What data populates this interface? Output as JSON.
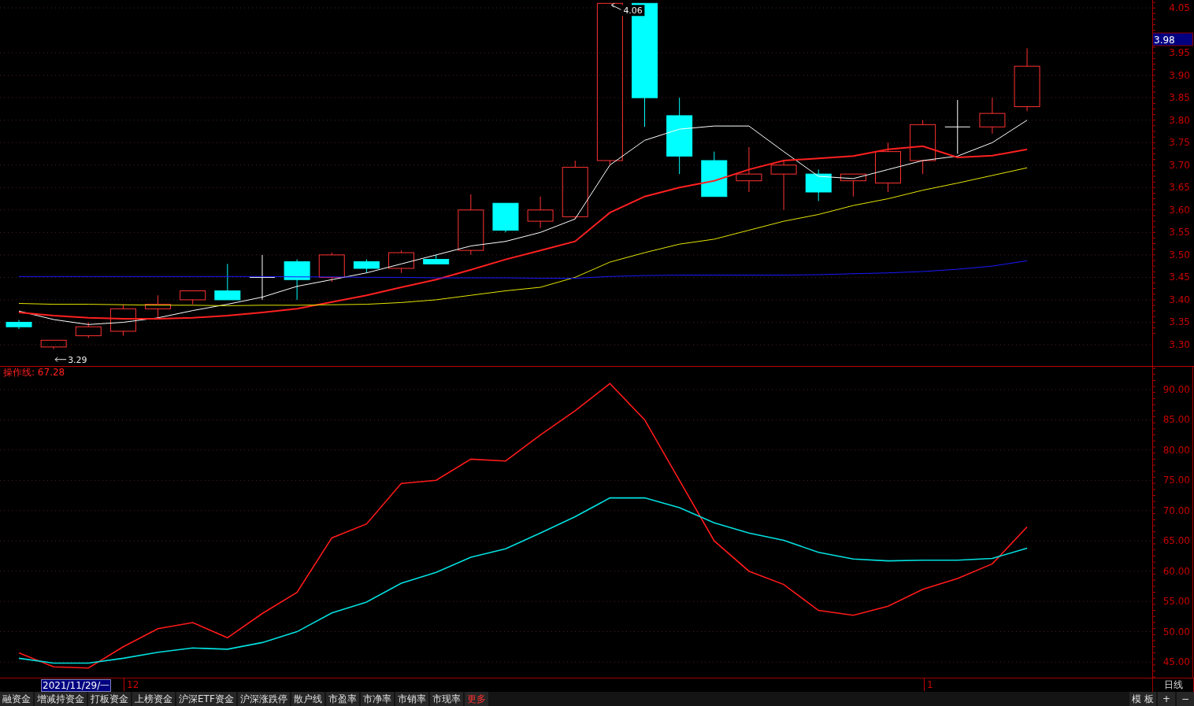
{
  "price_chart": {
    "chart_data": {
      "type": "line",
      "grid": true,
      "ylim": [
        3.3,
        4.05
      ],
      "yticks": [
        {
          "value": 4.05,
          "label": "4.05"
        },
        {
          "value": 3.95,
          "label": "3.95"
        },
        {
          "value": 3.9,
          "label": "3.90"
        },
        {
          "value": 3.85,
          "label": "3.85"
        },
        {
          "value": 3.8,
          "label": "3.80"
        },
        {
          "value": 3.75,
          "label": "3.75"
        },
        {
          "value": 3.7,
          "label": "3.70"
        },
        {
          "value": 3.65,
          "label": "3.65"
        },
        {
          "value": 3.6,
          "label": "3.60"
        },
        {
          "value": 3.55,
          "label": "3.55"
        },
        {
          "value": 3.5,
          "label": "3.50"
        },
        {
          "value": 3.45,
          "label": "3.45"
        },
        {
          "value": 3.4,
          "label": "3.40"
        },
        {
          "value": 3.35,
          "label": "3.35"
        },
        {
          "value": 3.3,
          "label": "3.30"
        }
      ],
      "series": [
        {
          "color": "#ffffff",
          "values": [
            3.375,
            3.356,
            3.345,
            3.35,
            3.36,
            3.376,
            3.39,
            3.406,
            3.43,
            3.445,
            3.46,
            3.48,
            3.5,
            3.52,
            3.53,
            3.55,
            3.58,
            3.7,
            3.755,
            3.78,
            3.787,
            3.787,
            3.73,
            3.675,
            3.67,
            3.69,
            3.71,
            3.72,
            3.75,
            3.8
          ]
        },
        {
          "color": "#ff2020",
          "values": [
            3.372,
            3.365,
            3.36,
            3.358,
            3.358,
            3.36,
            3.365,
            3.372,
            3.38,
            3.395,
            3.41,
            3.428,
            3.445,
            3.467,
            3.49,
            3.51,
            3.53,
            3.594,
            3.63,
            3.65,
            3.665,
            3.69,
            3.71,
            3.715,
            3.72,
            3.735,
            3.742,
            3.717,
            3.721,
            3.735
          ]
        },
        {
          "color": "#e6e600",
          "values": [
            3.392,
            3.39,
            3.39,
            3.389,
            3.388,
            3.388,
            3.387,
            3.388,
            3.388,
            3.389,
            3.39,
            3.394,
            3.4,
            3.41,
            3.42,
            3.428,
            3.45,
            3.484,
            3.505,
            3.524,
            3.535,
            3.555,
            3.575,
            3.59,
            3.61,
            3.625,
            3.644,
            3.66,
            3.677,
            3.694
          ]
        },
        {
          "color": "#1a1aff",
          "values": [
            3.452,
            3.452,
            3.452,
            3.452,
            3.452,
            3.452,
            3.452,
            3.452,
            3.451,
            3.451,
            3.45,
            3.45,
            3.449,
            3.449,
            3.449,
            3.448,
            3.448,
            3.452,
            3.454,
            3.455,
            3.455,
            3.455,
            3.455,
            3.456,
            3.458,
            3.46,
            3.463,
            3.468,
            3.475,
            3.487
          ]
        }
      ],
      "annotations": [
        {
          "text": "4.06"
        },
        {
          "text": "3.29"
        }
      ]
    },
    "price_tag": "3.98"
  },
  "indicator_chart": {
    "legend": "操作线: 67.28",
    "chart_data": {
      "type": "line",
      "grid": true,
      "ylim": [
        42.4,
        93.9
      ],
      "yticks": [
        {
          "value": 90,
          "label": "90.00"
        },
        {
          "value": 85,
          "label": "85.00"
        },
        {
          "value": 80,
          "label": "80.00"
        },
        {
          "value": 75,
          "label": "75.00"
        },
        {
          "value": 70,
          "label": "70.00"
        },
        {
          "value": 65,
          "label": "65.00"
        },
        {
          "value": 60,
          "label": "60.00"
        },
        {
          "value": 55,
          "label": "55.00"
        },
        {
          "value": 50,
          "label": "50.00"
        },
        {
          "value": 45,
          "label": "45.00"
        }
      ],
      "series": [
        {
          "color": "#ff1a1a",
          "values": [
            46.5,
            44.2,
            44.0,
            47.5,
            50.5,
            51.5,
            49.0,
            53.0,
            56.5,
            65.5,
            67.8,
            74.5,
            75.0,
            78.5,
            78.2,
            82.5,
            86.5,
            91.0,
            85.0,
            75.0,
            65.0,
            60.0,
            57.8,
            53.5,
            52.7,
            54.2,
            57.0,
            58.8,
            61.2,
            67.3
          ]
        },
        {
          "color": "#00e0e0",
          "values": [
            45.6,
            44.8,
            44.8,
            45.6,
            46.6,
            47.3,
            47.1,
            48.2,
            50.0,
            53.1,
            54.9,
            58.0,
            59.8,
            62.3,
            63.7,
            66.3,
            69.0,
            72.1,
            72.1,
            70.5,
            68.0,
            66.3,
            65.1,
            63.1,
            62.0,
            61.7,
            61.8,
            61.8,
            62.1,
            63.8
          ]
        }
      ]
    }
  },
  "date_strip": {
    "cursor_date": "2021/11/29/一",
    "month_marks": [
      "12",
      "1"
    ],
    "period": "日线"
  },
  "tabs": [
    {
      "label": "融资金",
      "kind": "tab"
    },
    {
      "label": "增减持资金",
      "kind": "tab"
    },
    {
      "label": "打板资金",
      "kind": "tab"
    },
    {
      "label": "上榜资金",
      "kind": "tab"
    },
    {
      "label": "沪深ETF资金",
      "kind": "tab"
    },
    {
      "label": "沪深涨跌停",
      "kind": "tab"
    },
    {
      "label": "散户线",
      "kind": "tab"
    },
    {
      "label": "市盈率",
      "kind": "tab"
    },
    {
      "label": "市净率",
      "kind": "tab"
    },
    {
      "label": "市销率",
      "kind": "tab"
    },
    {
      "label": "市现率",
      "kind": "tab"
    },
    {
      "label": "更多",
      "kind": "more"
    }
  ],
  "right_buttons": [
    "模 板",
    "+",
    "−"
  ]
}
